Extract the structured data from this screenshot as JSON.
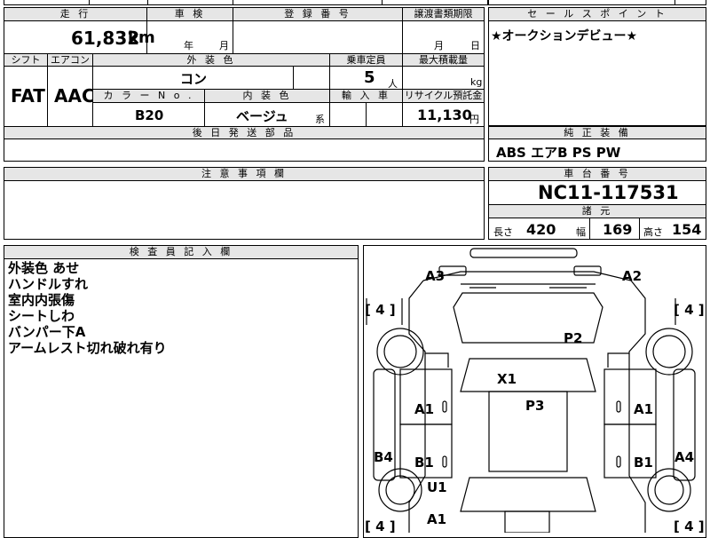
{
  "headers": {
    "mileage": "走 行",
    "inspection": "車 検",
    "registration": "登 録 番 号",
    "transfer": "譲渡書類期限",
    "sales_point": "セ ー ル ス ポ イ ン ト",
    "shift": "シフト",
    "aircon": "エアコン",
    "exterior_color": "外 装 色",
    "capacity": "乗車定員",
    "max_load": "最大積載量",
    "color_no": "カ ラ ー N o .",
    "interior_color": "内 装 色",
    "import": "輸 入 車",
    "recycle": "リサイクル預託金",
    "later_parts": "後 日 発 送 部 品",
    "genuine_equipment": "純 正 装 備",
    "notes": "注 意 事 項 欄",
    "chassis_no": "車 台 番 号",
    "specs": "諸 元",
    "inspector": "検 査 員 記 入 欄"
  },
  "values": {
    "mileage": "61,832",
    "mileage_unit": "km",
    "inspection_year": "年",
    "inspection_month": "月",
    "transfer_month": "月",
    "transfer_day": "日",
    "sales_point": "★オークションデビュー★",
    "shift": "FAT",
    "aircon": "AAC",
    "exterior_color": "コン",
    "capacity": "5",
    "capacity_unit": "人",
    "max_load_unit": "kg",
    "color_no": "B20",
    "interior_color": "ベージュ",
    "interior_suffix": "系",
    "recycle": "11,130",
    "recycle_unit": "円",
    "genuine_equipment": "ABS エアB PS PW",
    "chassis_no": "NC11-117531",
    "length_label": "長さ",
    "length": "420",
    "width_label": "幅",
    "width": "169",
    "height_label": "高さ",
    "height": "154"
  },
  "inspector_notes": [
    "外装色 あせ",
    "ハンドルすれ",
    "室内内張傷",
    "シートしわ",
    "バンパー下A",
    "アームレスト切れ破れ有り"
  ],
  "diagram_marks": {
    "front_left": "A3",
    "front_right": "A2",
    "hood": "P2",
    "windshield": "X1",
    "roof": "P3",
    "left_front_door": "A1",
    "right_front_door": "A1",
    "left_rear_door": "B1",
    "right_rear_door": "B1",
    "left_sill": "B4",
    "right_sill": "A4",
    "left_rear_fender": "U1",
    "left_rear_quarter": "A1",
    "tire_fl": "[ 4 ]",
    "tire_fr": "[ 4 ]",
    "tire_rl": "[ 4 ]",
    "tire_rr": "[ 4 ]"
  }
}
